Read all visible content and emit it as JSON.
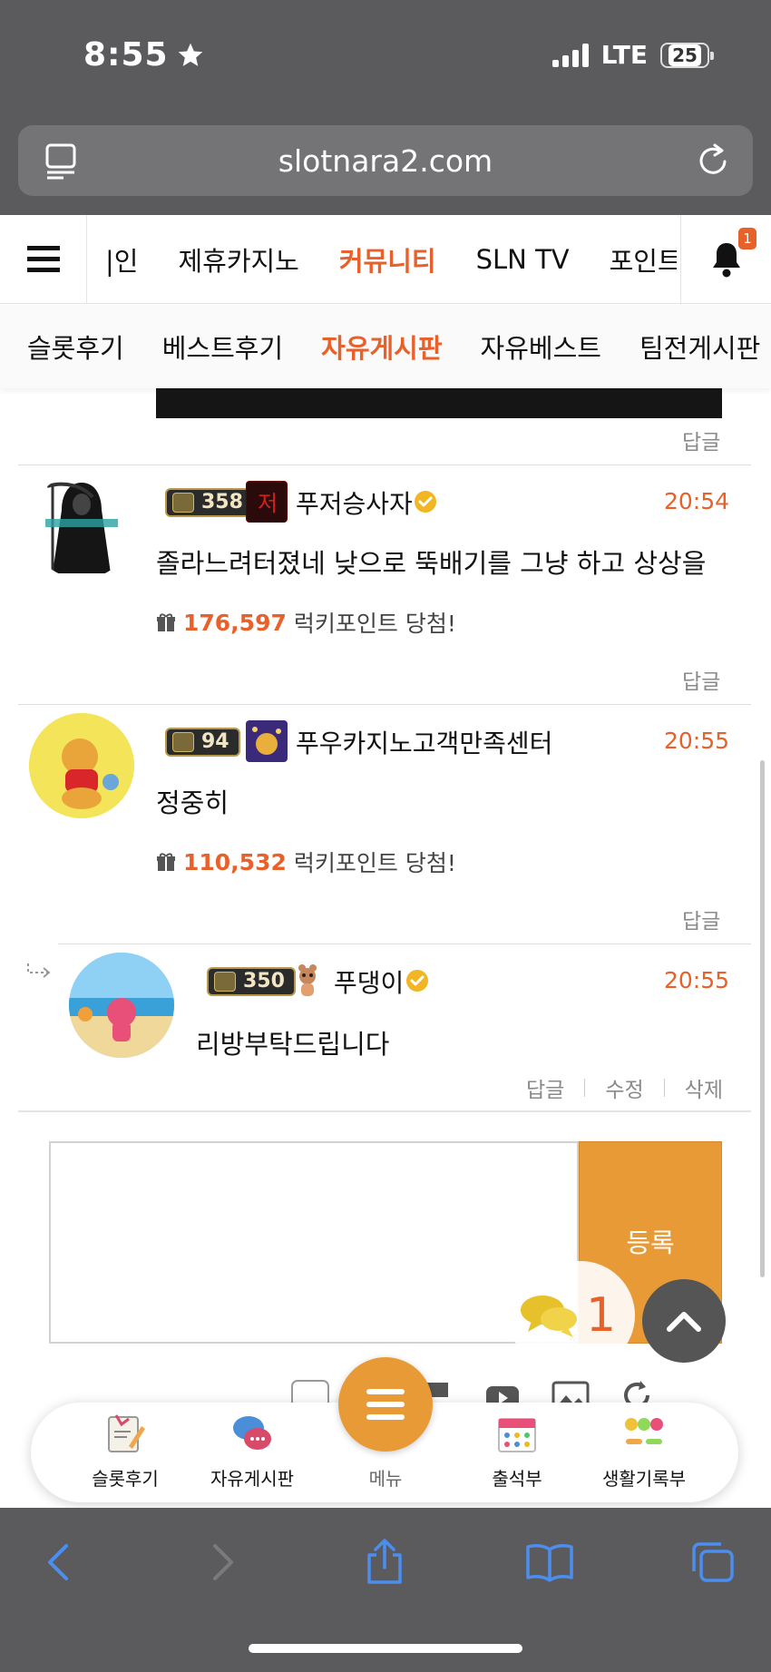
{
  "status_bar": {
    "time": "8:55",
    "network": "LTE",
    "battery": "25"
  },
  "browser": {
    "url": "slotnara2.com"
  },
  "main_nav": {
    "items": [
      "|인",
      "제휴카지노",
      "커뮤니티",
      "SLN TV",
      "포인트"
    ],
    "active_index": 2,
    "notification_count": "1"
  },
  "sub_nav": {
    "items": [
      "슬롯후기",
      "베스트후기",
      "자유게시판",
      "자유베스트",
      "팀전게시판"
    ],
    "active_index": 2
  },
  "reply_label": "답글",
  "comments": [
    {
      "level": "358",
      "nickname": "푸저승사자",
      "verified": true,
      "time": "20:54",
      "text": "졸라느려터졌네 낮으로 뚝배기를 그냥 하고 상상을",
      "points": "176,597",
      "points_text": "럭키포인트 당첨!",
      "reply": "답글"
    },
    {
      "level": "94",
      "nickname": "푸우카지노고객만족센터",
      "verified": false,
      "time": "20:55",
      "text": "정중히",
      "points": "110,532",
      "points_text": "럭키포인트 당첨!",
      "reply": "답글"
    },
    {
      "level": "350",
      "nickname": "푸댕이",
      "verified": true,
      "time": "20:55",
      "text": "리방부탁드립니다",
      "actions": [
        "답글",
        "수정",
        "삭제"
      ]
    }
  ],
  "write_box": {
    "submit_label": "등록"
  },
  "chat_count": "1",
  "app_menu": {
    "items": [
      "슬롯후기",
      "자유게시판",
      "메뉴",
      "출석부",
      "생활기록부"
    ]
  },
  "colors": {
    "accent": "#e8602a",
    "button": "#e89a37",
    "chrome": "#5b5b5d"
  }
}
